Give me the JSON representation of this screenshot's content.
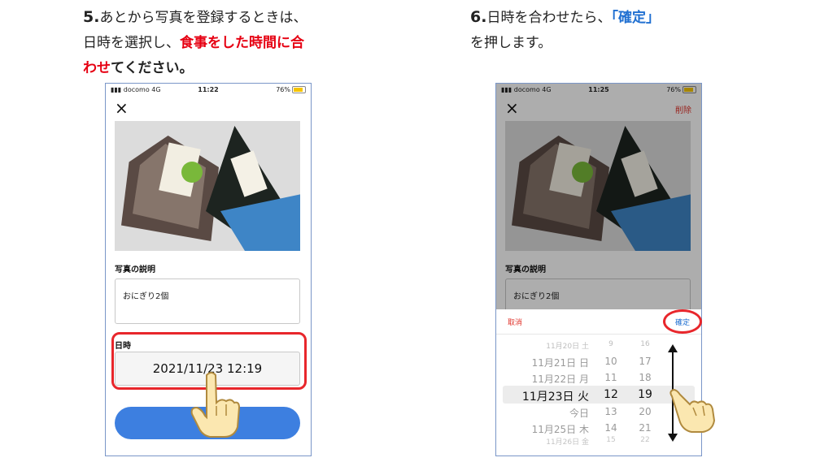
{
  "left_step": {
    "number": "5.",
    "line1": "あとから写真を登録するときは、",
    "line2_plain": "日時を選択し、",
    "line2_red": "食事をした時間に合",
    "line3_red": "わせ",
    "line3_bold": "てください。"
  },
  "right_step": {
    "number": "6.",
    "line1_plain": "日時を合わせたら、",
    "line1_blue": "「確定」",
    "line2": "を押します。"
  },
  "phone1": {
    "carrier": "docomo",
    "network": "4G",
    "time": "11:22",
    "battery": "76%",
    "close_icon": "×",
    "description_label": "写真の説明",
    "description_value": "おにぎり2個",
    "datetime_label": "日時",
    "datetime_value": "2021/11/23 12:19",
    "submit_color": "#3d7fe0"
  },
  "phone2": {
    "carrier": "docomo",
    "network": "4G",
    "time": "11:25",
    "battery": "76%",
    "close_icon": "×",
    "delete_label": "削除",
    "description_label": "写真の説明",
    "description_value": "おにぎり2個",
    "cancel_label": "取消",
    "confirm_label": "確定",
    "picker_rows": [
      {
        "date": "11月20日 土",
        "hour": "9",
        "minute": "16"
      },
      {
        "date": "11月21日 日",
        "hour": "10",
        "minute": "17"
      },
      {
        "date": "11月22日 月",
        "hour": "11",
        "minute": "18"
      },
      {
        "date": "11月23日 火",
        "hour": "12",
        "minute": "19"
      },
      {
        "date": "今日",
        "hour": "13",
        "minute": "20"
      },
      {
        "date": "11月25日 木",
        "hour": "14",
        "minute": "21"
      },
      {
        "date": "11月26日 金",
        "hour": "15",
        "minute": "22"
      }
    ]
  },
  "colors": {
    "highlight_red": "#e8262b",
    "confirm_blue": "#1f6fd1",
    "delete_red": "#e0342c"
  }
}
